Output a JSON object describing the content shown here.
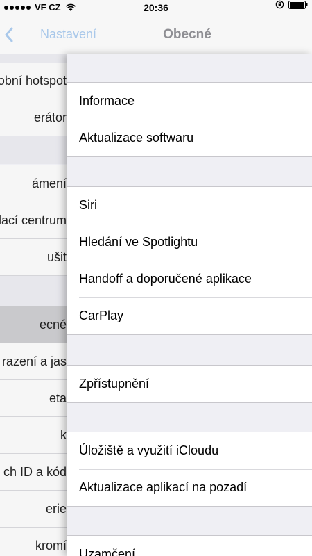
{
  "status_bar": {
    "carrier": "VF CZ",
    "time": "20:36",
    "icons": [
      "signal-dots",
      "wifi-icon",
      "rotation-lock-icon",
      "battery-icon"
    ]
  },
  "nav": {
    "back_label": "Nastavení",
    "title": "Obecné",
    "back_color": "#a9c8ea",
    "title_color": "#8e8e93"
  },
  "parent_list": {
    "items": [
      "obní hotspot",
      "erátor",
      "ámení",
      "ádací centrum",
      "ušit",
      "ecné",
      "razení a jas",
      "eta",
      "k",
      "ch ID a kód",
      "erie",
      "kromí"
    ],
    "selected_index": 5
  },
  "detail": {
    "groups": [
      {
        "items": [
          "Informace",
          "Aktualizace softwaru"
        ]
      },
      {
        "items": [
          "Siri",
          "Hledání ve Spotlightu",
          "Handoff a doporučené aplikace",
          "CarPlay"
        ]
      },
      {
        "items": [
          "Zpřístupnění"
        ]
      },
      {
        "items": [
          "Úložiště a využití iCloudu",
          "Aktualizace aplikací na pozadí"
        ]
      },
      {
        "items": [
          "Uzamčení"
        ]
      }
    ]
  }
}
